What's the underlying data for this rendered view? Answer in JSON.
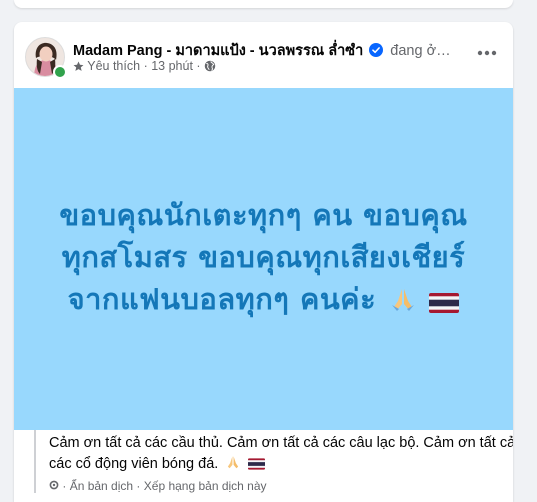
{
  "post": {
    "author": "Madam Pang - มาดามแป้ง - นวลพรรณ ล่ำซำ",
    "status": "đang ở…",
    "audience_label": "Yêu thích",
    "separator": "·",
    "time_ago": "13 phút",
    "banner_lines": [
      "ขอบคุณนักเตะทุกๆ คน ขอบคุณ",
      "ทุกสโมสร ขอบคุณทุกเสียงเชียร์",
      "จากแฟนบอลทุกๆ คนค่ะ"
    ],
    "banner_color": "#98d8fd",
    "banner_text_color": "#1477b8",
    "translation": "Cảm ơn tất cả các cầu thủ. Cảm ơn tất cả các câu lạc bộ. Cảm ơn tất cả các cổ động viên bóng đá.",
    "hide_translation": "Ẩn bản dịch",
    "rate_translation": "Xếp hạng bản dịch này",
    "link_separator": "·"
  },
  "colors": {
    "verified": "#0866ff",
    "online": "#31a24c",
    "secondary_text": "#65676b"
  }
}
